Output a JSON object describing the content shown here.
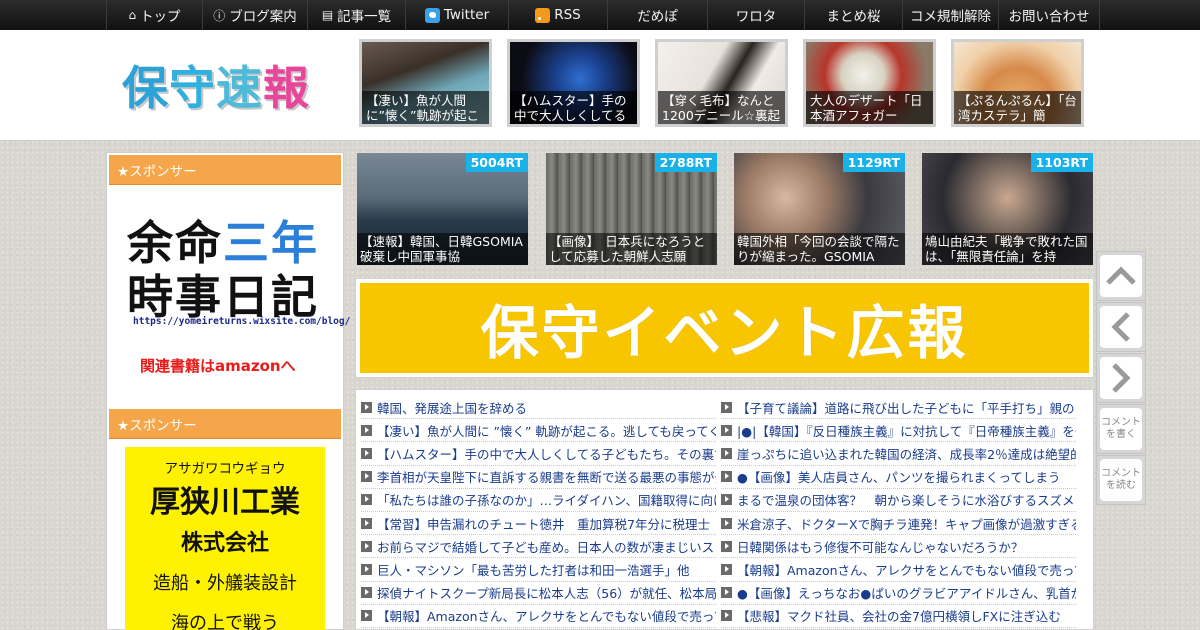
{
  "nav": {
    "items": [
      {
        "label": "トップ",
        "icon": "home-icon"
      },
      {
        "label": "ブログ案内",
        "icon": "info-icon"
      },
      {
        "label": "記事一覧",
        "icon": "list-icon"
      },
      {
        "label": "Twitter",
        "icon": "twitter-icon"
      },
      {
        "label": "RSS",
        "icon": "rss-icon"
      },
      {
        "label": "だめぽ",
        "icon": ""
      },
      {
        "label": "ワロタ",
        "icon": ""
      },
      {
        "label": "まとめ桜",
        "icon": ""
      },
      {
        "label": "コメ規制解除",
        "icon": ""
      },
      {
        "label": "お問い合わせ",
        "icon": ""
      }
    ]
  },
  "logo": {
    "text": "保守速報"
  },
  "header_thumbs": [
    {
      "caption": "【凄い】魚が人間に”懐く”軌跡が起こ"
    },
    {
      "caption": "【ハムスター】手の中で大人しくしてる"
    },
    {
      "caption": "【穿く毛布】なんと1200デニール☆裏起毛"
    },
    {
      "caption": "大人のデザート「日本酒アフォガー"
    },
    {
      "caption": "【ぷるんぷるん】「台湾カステラ」簡"
    }
  ],
  "sidebar": {
    "sponsor_label_1": "★スポンサー",
    "ad1": {
      "line1a": "余命",
      "line1b": "三年",
      "line2": "時事日記",
      "url": "https://yomeireturns.wixsite.com/blog/",
      "link": "関連書籍はamazonへ"
    },
    "sponsor_label_2": "★スポンサー",
    "ad2": {
      "kana": "アサガワコウギョウ",
      "name": "厚狭川工業",
      "corp": "株式会社",
      "desc": "造船・外艤装設計",
      "more": "海の上で戦う"
    }
  },
  "featured": [
    {
      "rt": "5004RT",
      "caption": "【速報】韓国、日韓GSOMIA破棄し中国軍事協"
    },
    {
      "rt": "2788RT",
      "caption": "【画像】　日本兵になろうとして応募した朝鮮人志願"
    },
    {
      "rt": "1129RT",
      "caption": "韓国外相「今回の会談で隔たりが縮まった。GSOMIA"
    },
    {
      "rt": "1103RT",
      "caption": "鳩山由紀夫「戦争で敗れた国は、「無限責任論」を持"
    }
  ],
  "banner": {
    "text": "保守イベント広報"
  },
  "articles_left": [
    "韓国、発展途上国を辞める",
    "【凄い】魚が人間に ”懐く” 軌跡が起こる。逃しても戻ってくる",
    "【ハムスター】手の中で大人しくしてる子どもたち。その裏で",
    "李首相が天皇陛下に直訴する親書を無断で送る最悪の事態が発",
    "「私たちは誰の子孫なのか」…ライダイハン、国籍取得に向け",
    "【常習】申告漏れのチュート徳井　重加算税7年分に税理士「巨",
    "お前らマジで結婚して子ども産め。日本人の数が凄まじいスピ",
    "巨人・マシソン「最も苦労した打者は和田一浩選手」他",
    "探偵ナイトスクープ新局長に松本人志（56）が就任、松本局長",
    "【朝報】Amazonさん、アレクサをとんでもない値段で売ってし"
  ],
  "articles_right": [
    "【子育て議論】道路に飛び出した子どもに「平手打ち」親のし",
    "|●|【韓国】『反日種族主義』に対抗して『日帝種族主義』を発",
    "崖っぷちに追い込まれた韓国の経済、成長率2％達成は絶望的か",
    "●【画像】美人店員さん、パンツを撮られまくってしまう",
    "まるで温泉の団体客？　朝から楽しそうに水浴びするスズメさ",
    "米倉涼子、ドクターXで胸チラ連発！キャプ画像が過激すぎる",
    "日韓関係はもう修復不可能なんじゃないだろうか？",
    "【朝報】Amazonさん、アレクサをとんでもない値段で売ってし",
    "●【画像】えっちなお●ぱいのグラビアアイドルさん、乳首が透",
    "【悲報】マクド社員、会社の金7億円横領しFXに注ぎ込む"
  ],
  "float_buttons": {
    "comment_write": "コメントを書く",
    "comment_read": "コメントを読む"
  }
}
